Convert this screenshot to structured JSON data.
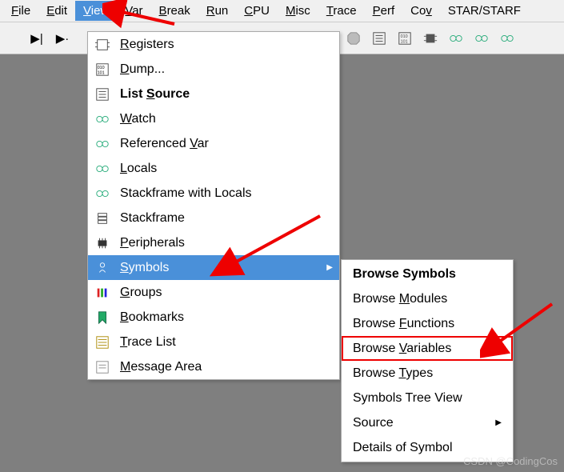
{
  "menubar": {
    "items": [
      {
        "label": "File",
        "u": 0
      },
      {
        "label": "Edit",
        "u": 0
      },
      {
        "label": "View",
        "u": 0,
        "active": true
      },
      {
        "label": "Var",
        "u": 0
      },
      {
        "label": "Break",
        "u": 0
      },
      {
        "label": "Run",
        "u": 0
      },
      {
        "label": "CPU",
        "u": 0
      },
      {
        "label": "Misc",
        "u": 0
      },
      {
        "label": "Trace",
        "u": 0
      },
      {
        "label": "Perf",
        "u": 0
      },
      {
        "label": "Cov",
        "u": 2
      },
      {
        "label": "STAR/STARF",
        "u": -1
      }
    ]
  },
  "toolbar": {
    "left": [
      "step-end",
      "step-next"
    ],
    "right": [
      "help",
      "stop",
      "list",
      "bin1",
      "chip",
      "car1",
      "car2",
      "car3"
    ]
  },
  "view_menu": {
    "items": [
      {
        "icon": "registers",
        "label": "Registers",
        "u": 0
      },
      {
        "icon": "dump",
        "label": "Dump...",
        "u": 0
      },
      {
        "icon": "list",
        "label": "List Source",
        "u": 5,
        "bold": true
      },
      {
        "icon": "watch",
        "label": "Watch",
        "u": 0
      },
      {
        "icon": "refvar",
        "label": "Referenced Var",
        "u": 11
      },
      {
        "icon": "locals",
        "label": "Locals",
        "u": 0
      },
      {
        "icon": "stackloc",
        "label": "Stackframe with Locals",
        "u": -1
      },
      {
        "icon": "stack",
        "label": "Stackframe",
        "u": -1
      },
      {
        "icon": "periph",
        "label": "Peripherals",
        "u": 0
      },
      {
        "icon": "symbols",
        "label": "Symbols",
        "u": 0,
        "selected": true,
        "submenu": true
      },
      {
        "icon": "groups",
        "label": "Groups",
        "u": 0
      },
      {
        "icon": "bookmarks",
        "label": "Bookmarks",
        "u": 0
      },
      {
        "icon": "tracelist",
        "label": "Trace List",
        "u": 0
      },
      {
        "icon": "msgarea",
        "label": "Message Area",
        "u": 0
      }
    ]
  },
  "symbols_submenu": {
    "items": [
      {
        "label": "Browse Symbols",
        "u": -1,
        "bold": true
      },
      {
        "label": "Browse Modules",
        "u": 7
      },
      {
        "label": "Browse Functions",
        "u": 7
      },
      {
        "label": "Browse Variables",
        "u": 7,
        "boxed": true
      },
      {
        "label": "Browse Types",
        "u": 7
      },
      {
        "label": "Symbols Tree View",
        "u": -1
      },
      {
        "label": "Source",
        "u": -1,
        "submenu": true
      },
      {
        "label": "Details of Symbol",
        "u": -1
      }
    ]
  },
  "watermark": "CSDN @CodingCos"
}
